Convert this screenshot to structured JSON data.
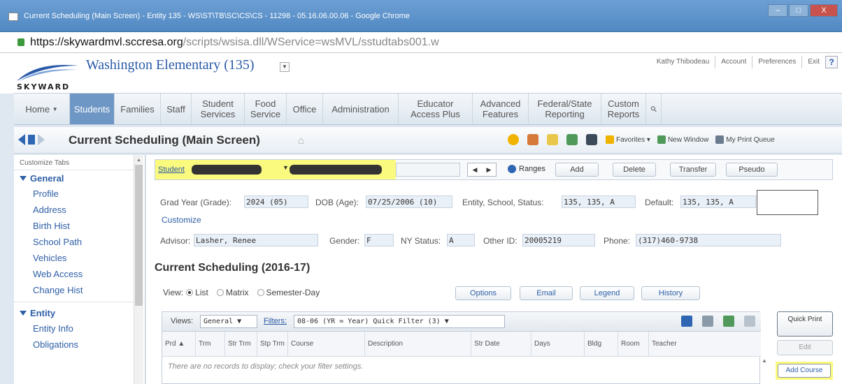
{
  "window": {
    "title": "Current Scheduling (Main Screen) - Entity 135 - WS\\ST\\TB\\SC\\CS\\CS - 11298 - 05.16.06.00.06 - Google Chrome",
    "min": "–",
    "max": "□",
    "close": "X"
  },
  "browser": {
    "url_host": "https://skywardmvl.sccresa.org",
    "url_path": "/scripts/wsisa.dll/WService=wsMVL/sstudtabs001.w"
  },
  "header": {
    "school": "Washington Elementary (135)",
    "user": "Kathy Thibodeau",
    "links": [
      "Account",
      "Preferences",
      "Exit"
    ],
    "help": "?"
  },
  "nav": [
    {
      "label": "Home",
      "has_dropdown": true
    },
    {
      "label": "Students",
      "active": true
    },
    {
      "label": "Families"
    },
    {
      "label": "Staff"
    },
    {
      "label": "Student Services"
    },
    {
      "label": "Food Service"
    },
    {
      "label": "Office"
    },
    {
      "label": "Administration"
    },
    {
      "label": "Educator Access Plus"
    },
    {
      "label": "Advanced Features"
    },
    {
      "label": "Federal/State Reporting"
    },
    {
      "label": "Custom Reports"
    }
  ],
  "toolbar": {
    "page_title": "Current Scheduling (Main Screen)",
    "favorites": "Favorites",
    "new_window": "New Window",
    "print_queue": "My Print Queue"
  },
  "sidebar": {
    "top": "Customize Tabs",
    "general": {
      "title": "General",
      "items": [
        "Profile",
        "Address",
        "Birth Hist",
        "School Path",
        "Vehicles",
        "Web Access",
        "Change Hist"
      ]
    },
    "entity": {
      "title": "Entity",
      "items": [
        "Entity Info",
        "Obligations"
      ]
    }
  },
  "student_bar": {
    "label": "Student",
    "ranges": "Ranges",
    "buttons": [
      "Add",
      "Delete",
      "Transfer",
      "Pseudo"
    ]
  },
  "student_info": {
    "grad_label": "Grad Year (Grade):",
    "grad": "2024 (05)",
    "dob_label": "DOB (Age):",
    "dob": "07/25/2006 (10)",
    "entity_label": "Entity, School, Status:",
    "entity": "135, 135, A",
    "default_label": "Default:",
    "default": "135, 135, A",
    "customize": "Customize",
    "advisor_label": "Advisor:",
    "advisor": "Lasher, Renee",
    "gender_label": "Gender:",
    "gender": "F",
    "ny_label": "NY Status:",
    "ny": "A",
    "other_label": "Other ID:",
    "other": "20005219",
    "phone_label": "Phone:",
    "phone": "(317)460-9738"
  },
  "schedule": {
    "title": "Current Scheduling (2016-17)",
    "view_label": "View:",
    "view_options": [
      "List",
      "Matrix",
      "Semester-Day"
    ],
    "view_selected": "List",
    "buttons": [
      "Options",
      "Email",
      "Legend",
      "History"
    ],
    "grid": {
      "views_label": "Views:",
      "views_value": "General",
      "filters_label": "Filters:",
      "filter_value": "08-06 (YR = Year) Quick Filter (3)",
      "columns": [
        "Prd",
        "Trm",
        "Str Trm",
        "Stp Trm",
        "Course",
        "Description",
        "Str Date",
        "Days",
        "Bldg",
        "Room",
        "Teacher"
      ],
      "empty_message": "There are no records to display; check your filter settings."
    },
    "side_buttons": {
      "quick_print": "Quick Print",
      "edit": "Edit",
      "add_course": "Add Course"
    }
  },
  "colors": {
    "nav_active": "#6e97c5",
    "highlight": "#fafa7e",
    "link": "#2e5fa6"
  }
}
